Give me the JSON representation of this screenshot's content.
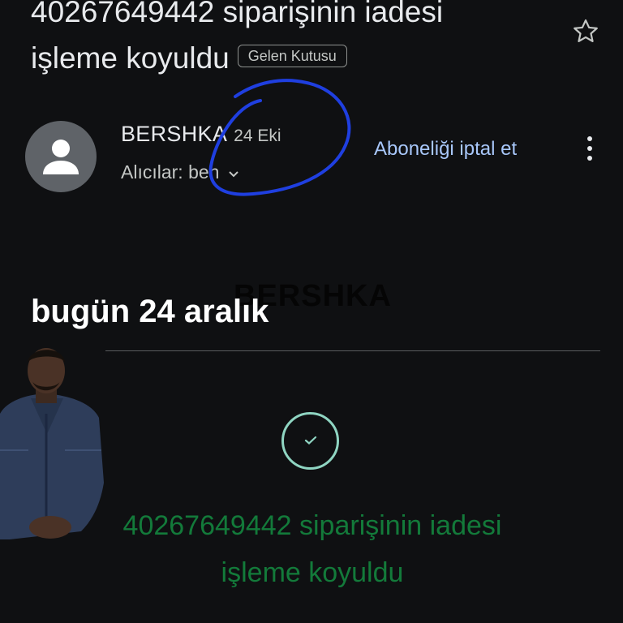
{
  "subject": {
    "line1": "40267649442 siparişinin iadesi",
    "line2": "işleme koyuldu",
    "label_chip": "Gelen Kutusu"
  },
  "actions": {
    "star_icon": "star-outline-icon",
    "more_icon": "vertical-dots-icon"
  },
  "sender": {
    "name": "BERSHKA",
    "date": "24 Eki",
    "recipients": "Alıcılar: ben",
    "unsubscribe": "Aboneliği iptal et"
  },
  "body": {
    "watermark": "BERSHKA",
    "date_heading": "bugün 24 aralık",
    "status_line1": "40267649442 siparişinin iadesi",
    "status_line2": "işleme koyuldu"
  },
  "colors": {
    "background": "#0f1012",
    "link": "#a8c7fa",
    "status_green": "#137a3a",
    "check_teal": "#8fd5c2",
    "scribble_blue": "#1f3fe0"
  }
}
